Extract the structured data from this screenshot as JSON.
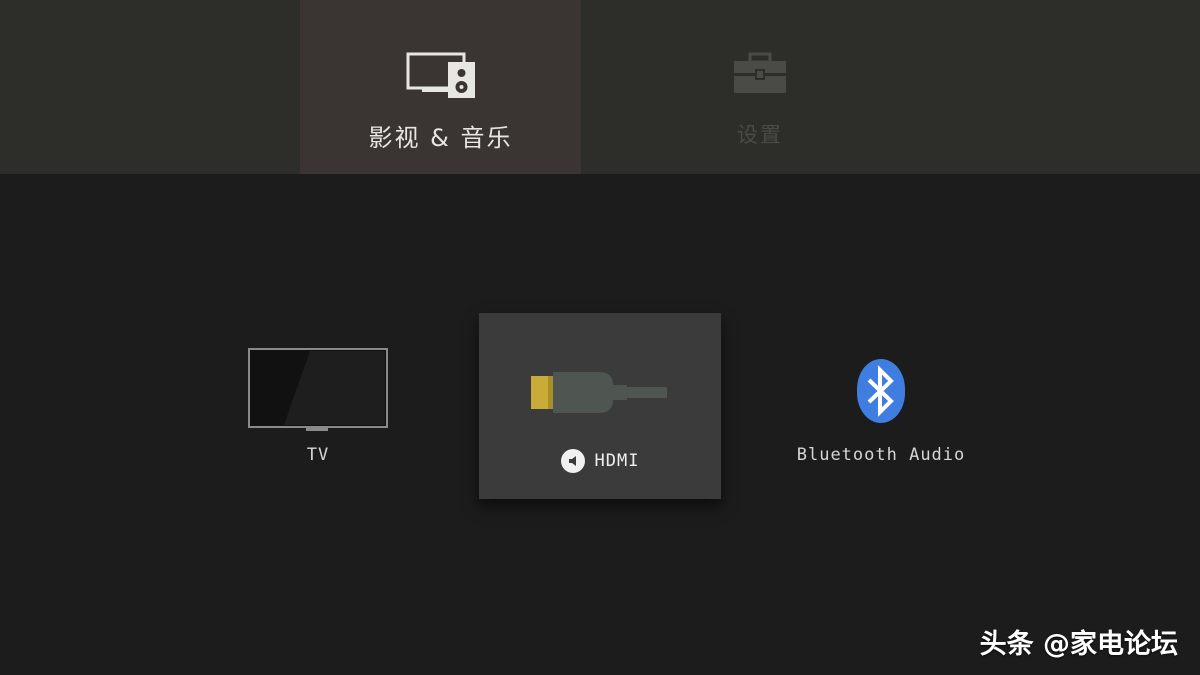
{
  "top_categories": {
    "items": [
      {
        "label": "影视 & 音乐",
        "icon": "monitor-speaker-icon",
        "selected": true
      },
      {
        "label": "设置",
        "icon": "toolbox-icon",
        "selected": false
      }
    ]
  },
  "outputs": {
    "items": [
      {
        "label": "TV",
        "icon": "tv-icon",
        "selected": false
      },
      {
        "label": "HDMI",
        "icon": "hdmi-cable-icon",
        "status_icon": "speaker-icon",
        "selected": true
      },
      {
        "label": "Bluetooth Audio",
        "icon": "bluetooth-icon",
        "selected": false
      }
    ]
  },
  "colors": {
    "background": "#1c1c1c",
    "topbar": "#2d2d29",
    "active_tab": "#3a3532",
    "focus_tile": "#3b3b3b",
    "bluetooth": "#3f7ee0",
    "hdmi_connector": "#c9ac37"
  },
  "watermark": {
    "text": "头条 @家电论坛"
  }
}
